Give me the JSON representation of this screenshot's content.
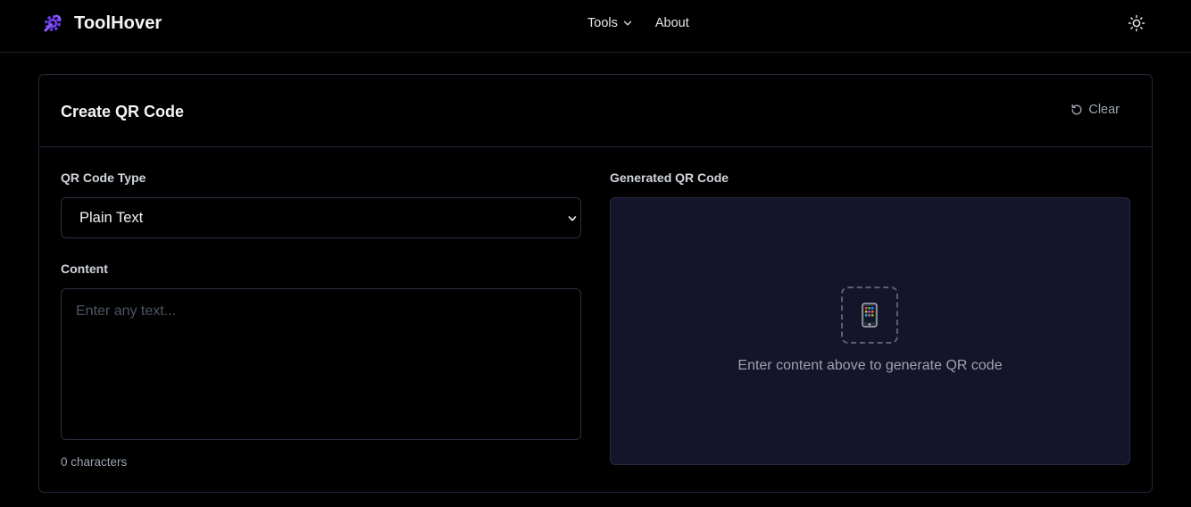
{
  "navbar": {
    "brand_name": "ToolHover",
    "brand_icon": "wrench-cog-icon",
    "links": {
      "tools": "Tools",
      "about": "About"
    },
    "theme_icon": "sun-icon"
  },
  "card": {
    "title": "Create QR Code",
    "clear_label": "Clear",
    "qr_type_label": "QR Code Type",
    "qr_type_selected": "Plain Text",
    "content_label": "Content",
    "content_value": "",
    "content_placeholder": "Enter any text...",
    "char_count": "0 characters",
    "generated_label": "Generated QR Code",
    "placeholder_icon": "mobile-phone-icon",
    "placeholder_hint": "Enter content above to generate QR code"
  },
  "colors": {
    "accent": "#6d3df0",
    "background": "#000000",
    "panel": "#14142a",
    "border": "#23283a"
  }
}
